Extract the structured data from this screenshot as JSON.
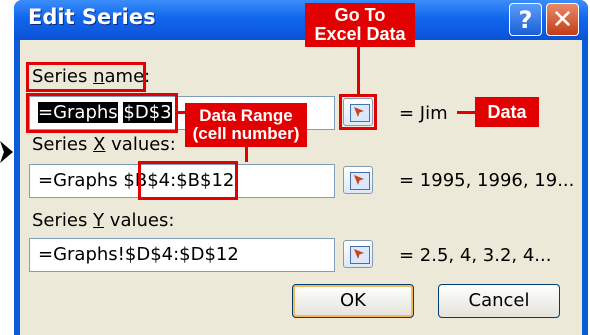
{
  "dialog": {
    "title": "Edit Series",
    "help_glyph": "?",
    "close_glyph": "✕"
  },
  "series_name": {
    "label_pre": "Series ",
    "label_accel": "n",
    "label_post": "ame:",
    "value_prefix": "=Graphs",
    "value_ref": "$D$3",
    "result": "= Jim"
  },
  "series_x": {
    "label_pre": "Series ",
    "label_accel": "X",
    "label_post": " values:",
    "value_prefix": "=Graphs",
    "value_ref": "$B$4:$B$12",
    "result": "= 1995, 1996, 19..."
  },
  "series_y": {
    "label_pre": "Series ",
    "label_accel": "Y",
    "label_post": " values:",
    "value": "=Graphs!$D$4:$D$12",
    "result": "= 2.5, 4, 3.2, 4..."
  },
  "buttons": {
    "ok": "OK",
    "cancel": "Cancel"
  },
  "annotations": {
    "goto_excel": [
      "Go To",
      "Excel Data"
    ],
    "data_range": [
      "Data Range",
      "(cell number)"
    ],
    "data": "Data",
    "color": "#e30000"
  },
  "icons": {
    "range_button": "range-select-icon",
    "pointer": "arrow-pointer-icon"
  }
}
